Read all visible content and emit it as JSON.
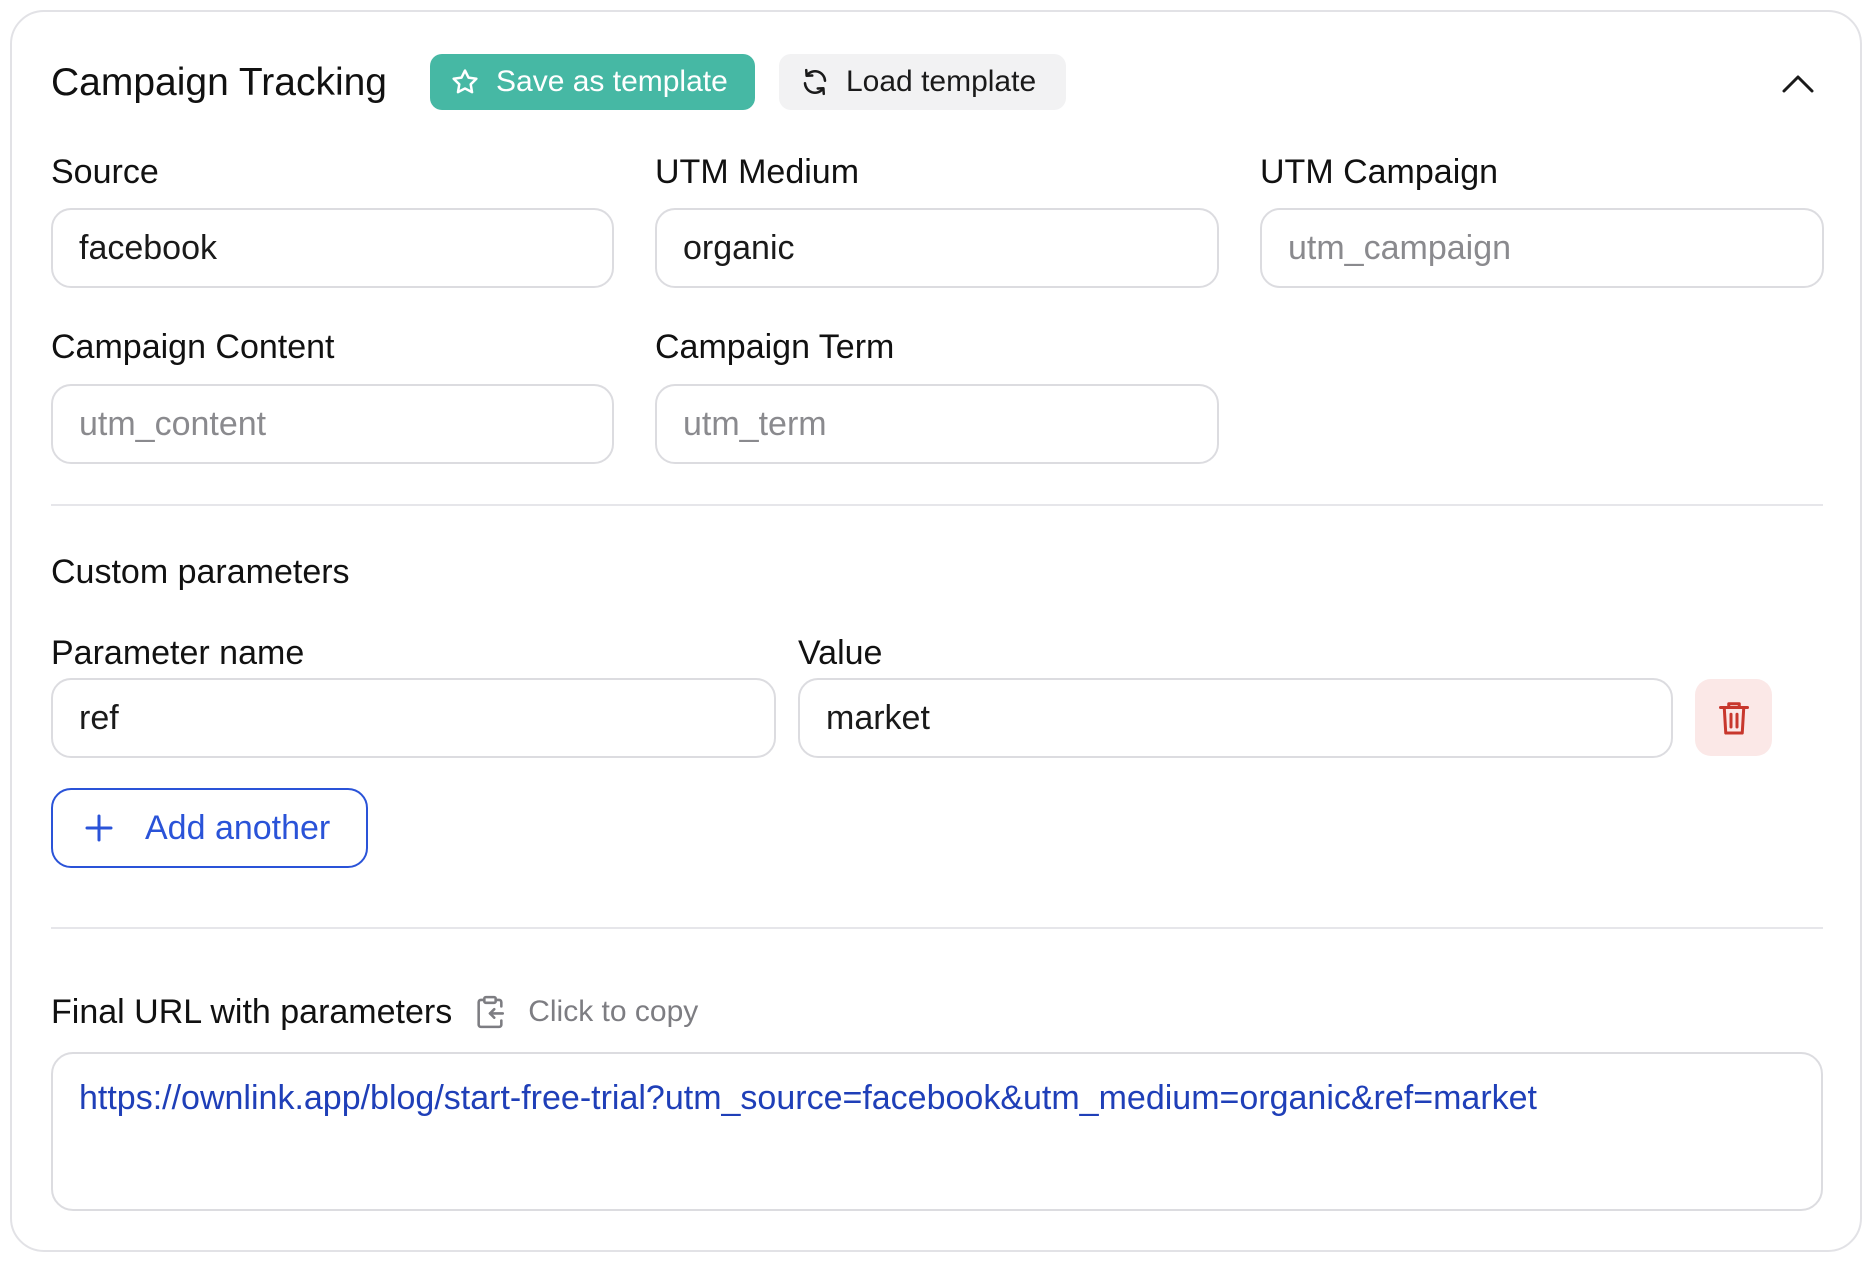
{
  "header": {
    "title": "Campaign Tracking",
    "save_template_label": "Save as template",
    "load_template_label": "Load template"
  },
  "fields": {
    "source": {
      "label": "Source",
      "value": "facebook",
      "placeholder": ""
    },
    "utm_medium": {
      "label": "UTM Medium",
      "value": "organic",
      "placeholder": ""
    },
    "utm_campaign": {
      "label": "UTM Campaign",
      "value": "",
      "placeholder": "utm_campaign"
    },
    "campaign_content": {
      "label": "Campaign Content",
      "value": "",
      "placeholder": "utm_content"
    },
    "campaign_term": {
      "label": "Campaign Term",
      "value": "",
      "placeholder": "utm_term"
    }
  },
  "custom": {
    "title": "Custom parameters",
    "param_name_label": "Parameter name",
    "value_label": "Value",
    "rows": [
      {
        "name": "ref",
        "value": "market"
      }
    ],
    "add_label": "Add another"
  },
  "final_url": {
    "label": "Final URL with parameters",
    "copy_label": "Click to copy",
    "url": "https://ownlink.app/blog/start-free-trial?utm_source=facebook&utm_medium=organic&ref=market"
  },
  "icons": {
    "save": "star-icon",
    "load": "refresh-icon",
    "collapse": "chevron-up-icon",
    "delete": "trash-icon",
    "add": "plus-icon",
    "copy": "clipboard-icon"
  },
  "colors": {
    "accent_teal": "#46b8a4",
    "link_blue": "#2a53d8",
    "url_text": "#1f3fb8",
    "danger_red": "#c8372d",
    "danger_bg": "#fbe8e7"
  }
}
